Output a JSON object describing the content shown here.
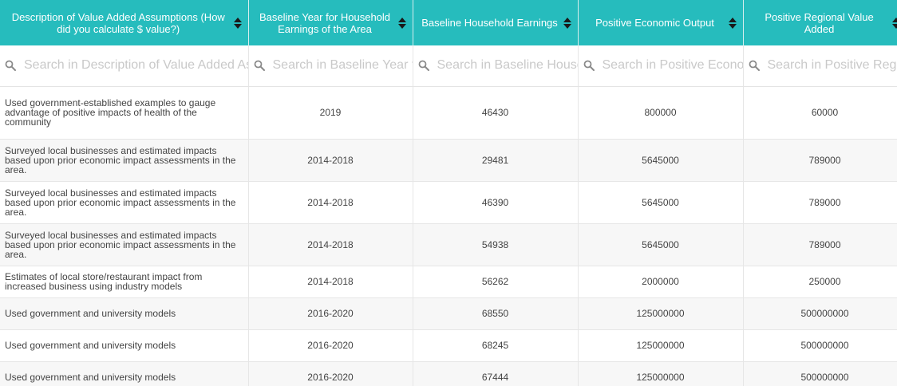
{
  "table": {
    "columns": [
      {
        "key": "description",
        "label": "Description of Value Added Assumptions (How did you calculate $ value?)",
        "search_placeholder": "Search in Description of Value Added Assumptions"
      },
      {
        "key": "baseline_year",
        "label": "Baseline Year for Household Earnings of the Area",
        "search_placeholder": "Search in Baseline Year for Household Earnings of the Area"
      },
      {
        "key": "baseline_earnings",
        "label": "Baseline Household Earnings",
        "search_placeholder": "Search in Baseline Household Earnings"
      },
      {
        "key": "economic_output",
        "label": "Positive Economic Output",
        "search_placeholder": "Search in Positive Economic Output"
      },
      {
        "key": "regional_value",
        "label": "Positive Regional Value Added",
        "search_placeholder": "Search in Positive Regional Value Added"
      }
    ],
    "rows": [
      {
        "description": "Used government-established examples to gauge advantage of positive impacts of health of the community",
        "baseline_year": "2019",
        "baseline_earnings": "46430",
        "economic_output": "800000",
        "regional_value": "60000"
      },
      {
        "description": "Surveyed local businesses and estimated impacts based upon prior economic impact assessments in the area.",
        "baseline_year": "2014-2018",
        "baseline_earnings": "29481",
        "economic_output": "5645000",
        "regional_value": "789000"
      },
      {
        "description": "Surveyed local businesses and estimated impacts based upon prior economic impact assessments in the area.",
        "baseline_year": "2014-2018",
        "baseline_earnings": "46390",
        "economic_output": "5645000",
        "regional_value": "789000"
      },
      {
        "description": "Surveyed local businesses and estimated impacts based upon prior economic impact assessments in the area.",
        "baseline_year": "2014-2018",
        "baseline_earnings": "54938",
        "economic_output": "5645000",
        "regional_value": "789000"
      },
      {
        "description": "Estimates of local store/restaurant impact from increased business using industry models",
        "baseline_year": "2014-2018",
        "baseline_earnings": "56262",
        "economic_output": "2000000",
        "regional_value": "250000"
      },
      {
        "description": "Used government and university models",
        "baseline_year": "2016-2020",
        "baseline_earnings": "68550",
        "economic_output": "125000000",
        "regional_value": "500000000"
      },
      {
        "description": "Used government and university models",
        "baseline_year": "2016-2020",
        "baseline_earnings": "68245",
        "economic_output": "125000000",
        "regional_value": "500000000"
      },
      {
        "description": "Used government and university models",
        "baseline_year": "2016-2020",
        "baseline_earnings": "67444",
        "economic_output": "125000000",
        "regional_value": "500000000"
      }
    ]
  },
  "colors": {
    "header_bg": "#26bcbd",
    "header_text": "#ffffff",
    "row_alt": "#f7f7f7",
    "placeholder": "#c9c9c9"
  },
  "icons": {
    "sort": "sort-updown-icon",
    "search": "search-icon"
  }
}
